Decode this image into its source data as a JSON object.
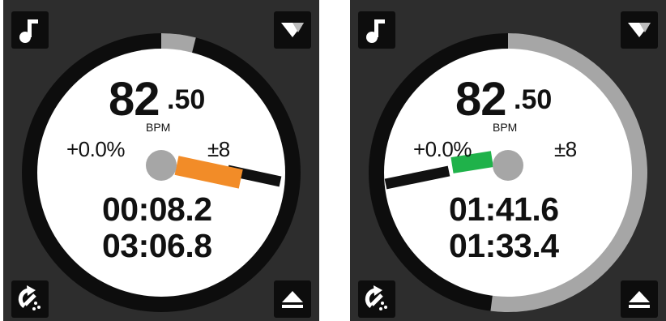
{
  "decks": [
    {
      "bpm": {
        "integer": "82",
        "decimal": ".50",
        "unit": "BPM"
      },
      "pitch": {
        "value": "+0.0%",
        "range": "±8"
      },
      "time": {
        "elapsed": "00:08.2",
        "remaining": "03:06.8"
      },
      "track_progress": 0.04,
      "slider_color": "#f28c28",
      "buttons": {
        "top_left": "music-note-icon",
        "top_right": "triangle-down-icon",
        "bottom_left": "sync-icon",
        "bottom_right": "eject-icon"
      }
    },
    {
      "bpm": {
        "integer": "82",
        "decimal": ".50",
        "unit": "BPM"
      },
      "pitch": {
        "value": "+0.0%",
        "range": "±8"
      },
      "time": {
        "elapsed": "01:41.6",
        "remaining": "01:33.4"
      },
      "track_progress": 0.52,
      "slider_color": "#1fb24a",
      "buttons": {
        "top_left": "music-note-icon",
        "top_right": "triangle-down-icon",
        "bottom_left": "sync-icon",
        "bottom_right": "eject-icon"
      }
    }
  ],
  "colors": {
    "ring": "#0d0d0d",
    "progress": "#a6a6a6",
    "deck_background": "#2d2d2d",
    "face": "#ffffff"
  }
}
